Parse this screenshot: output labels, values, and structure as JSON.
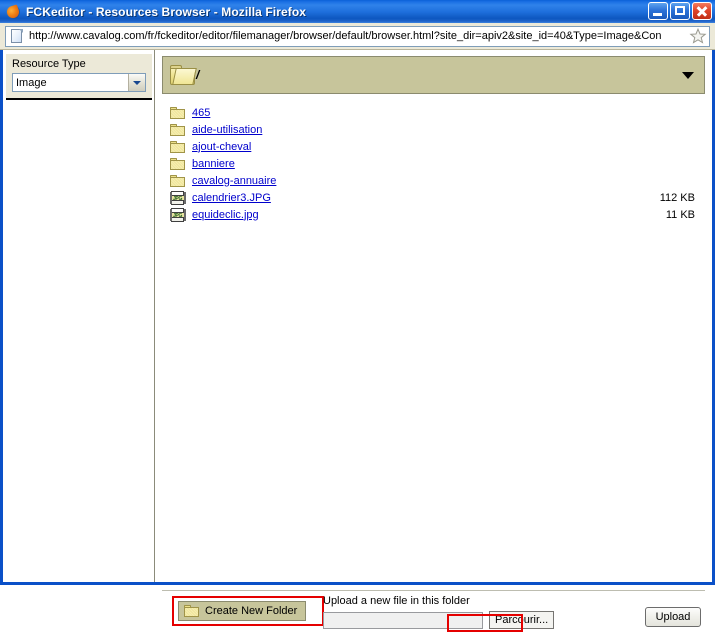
{
  "window": {
    "title": "FCKeditor - Resources Browser - Mozilla Firefox",
    "app_icon": "firefox-icon",
    "minimize_label": "",
    "maximize_label": "",
    "close_label": "",
    "titlebar_color": "#0a50c8"
  },
  "address_bar": {
    "page_icon": "page-icon",
    "url": "http://www.cavalog.com/fr/fckeditor/editor/filemanager/browser/default/browser.html?site_dir=apiv2&site_id=40&Type=Image&Con",
    "bookmark_icon": "star-icon"
  },
  "sidebar": {
    "resource_type_label": "Resource Type",
    "resource_type_value": "Image",
    "resource_type_options": [
      "Image"
    ]
  },
  "folder_bar": {
    "icon": "folder-icon",
    "path": "/",
    "dropdown_icon": "chevron-down-icon",
    "background_color": "#c7c59b"
  },
  "file_list": {
    "items": [
      {
        "icon": "folder-icon",
        "name": "465",
        "size": "",
        "type": "folder"
      },
      {
        "icon": "folder-icon",
        "name": "aide-utilisation",
        "size": "",
        "type": "folder"
      },
      {
        "icon": "folder-icon",
        "name": "ajout-cheval",
        "size": "",
        "type": "folder"
      },
      {
        "icon": "folder-icon",
        "name": "banniere",
        "size": "",
        "type": "folder"
      },
      {
        "icon": "folder-icon",
        "name": "cavalog-annuaire",
        "size": "",
        "type": "folder"
      },
      {
        "icon": "jpg-file-icon",
        "name": "calendrier3.JPG",
        "size": "112 KB",
        "type": "file",
        "icon_text": "JPG"
      },
      {
        "icon": "jpg-file-icon",
        "name": "equideclic.jpg",
        "size": "11 KB",
        "type": "file",
        "icon_text": "JPG"
      }
    ],
    "link_color": "#0000cc"
  },
  "bottom_bar": {
    "create_folder_label": "Create New Folder",
    "create_folder_icon": "folder-icon",
    "upload_section_label": "Upload a new file in this folder",
    "upload_input_value": "",
    "browse_label": "Parcourir...",
    "upload_label": "Upload"
  },
  "annotations": {
    "highlight_color": "#e50000",
    "boxes": [
      "create-new-folder-button",
      "browse-button"
    ]
  }
}
